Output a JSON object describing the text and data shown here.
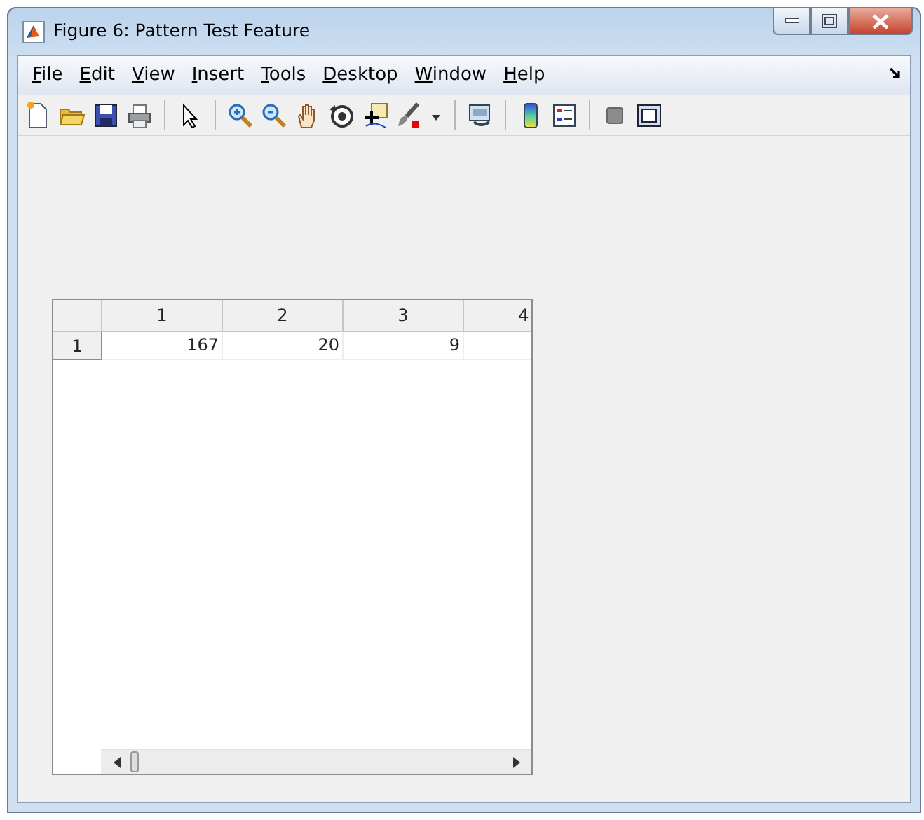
{
  "window": {
    "title": "Figure 6: Pattern Test Feature"
  },
  "menu": [
    {
      "label": "File"
    },
    {
      "label": "Edit"
    },
    {
      "label": "View"
    },
    {
      "label": "Insert"
    },
    {
      "label": "Tools"
    },
    {
      "label": "Desktop"
    },
    {
      "label": "Window"
    },
    {
      "label": "Help"
    }
  ],
  "table": {
    "columns": [
      "1",
      "2",
      "3",
      "4"
    ],
    "rows": [
      {
        "header": "1",
        "cells": [
          "167",
          "20",
          "9"
        ]
      }
    ]
  }
}
